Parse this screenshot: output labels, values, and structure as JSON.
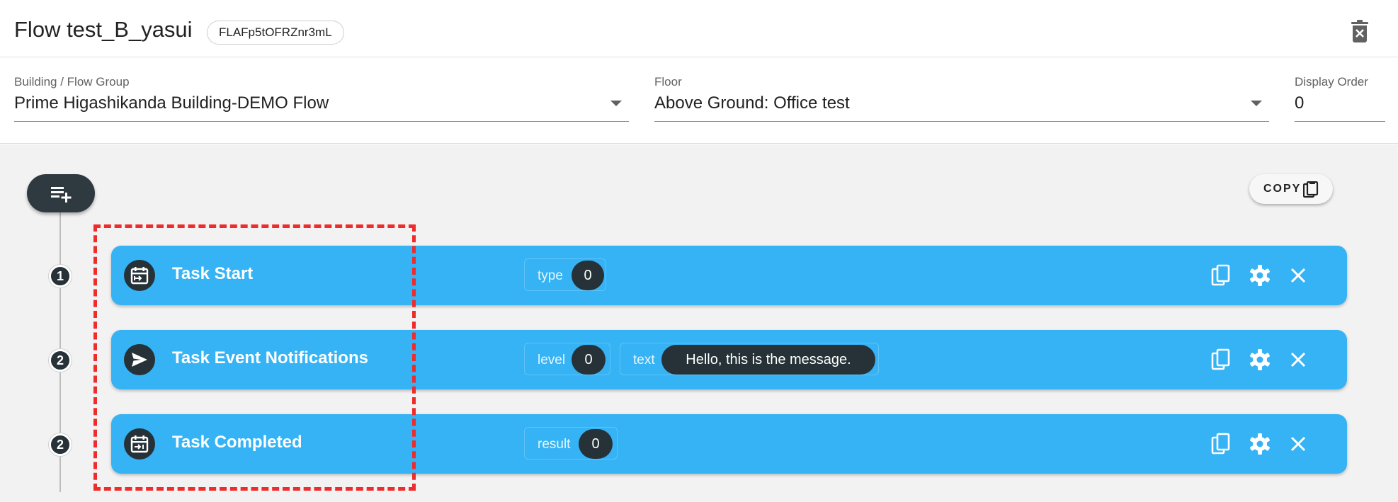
{
  "header": {
    "title": "Flow test_B_yasui",
    "flow_id": "FLAFp5tOFRZnr3mL",
    "delete_icon": "delete-icon"
  },
  "form": {
    "building": {
      "label": "Building / Flow Group",
      "value": "Prime Higashikanda Building-DEMO Flow"
    },
    "floor": {
      "label": "Floor",
      "value": "Above Ground: Office test"
    },
    "display_order": {
      "label": "Display Order",
      "value": "0"
    }
  },
  "toolbar": {
    "add_icon": "playlist-add-icon",
    "copy_label": "COPY",
    "copy_icon": "clipboard-icon"
  },
  "steps": [
    {
      "badge": "1",
      "name": "Task Start",
      "icon": "calendar-start-icon",
      "params": [
        {
          "key": "type",
          "value": "0"
        }
      ]
    },
    {
      "badge": "2",
      "name": "Task Event Notifications",
      "icon": "send-icon",
      "params": [
        {
          "key": "level",
          "value": "0"
        },
        {
          "key": "text",
          "value": "Hello, this is the message."
        }
      ]
    },
    {
      "badge": "2",
      "name": "Task Completed",
      "icon": "calendar-end-icon",
      "params": [
        {
          "key": "result",
          "value": "0"
        }
      ]
    }
  ],
  "card_actions": [
    "copy-icon",
    "gear-icon",
    "close-icon"
  ],
  "colors": {
    "card": "#35b3f5",
    "dark": "#263238",
    "highlight": "#ef2c2c",
    "canvas": "#f2f2f2"
  }
}
